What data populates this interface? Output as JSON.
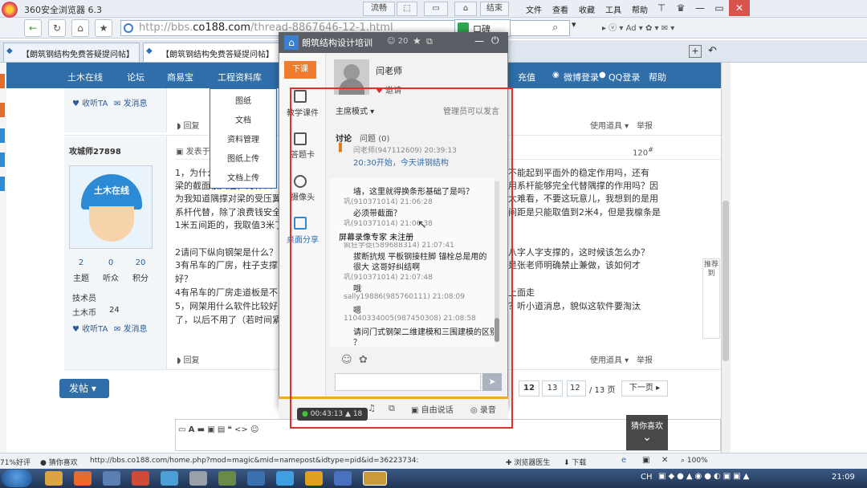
{
  "browser": {
    "title": "360安全浏览器 6.3",
    "top_buttons": [
      "流畅",
      "",
      "",
      "",
      "结束"
    ],
    "menus": [
      "文件",
      "查看",
      "收藏",
      "工具",
      "帮助"
    ],
    "url_prefix": "http://bbs.",
    "url_domain": "co188.com",
    "url_rest": "/thread-8867646-12-1.html",
    "search_label": "口碑",
    "tabs": [
      "【朗筑钢结构免费答疑提问帖】",
      "【朗筑钢结构免费答疑提问帖】"
    ]
  },
  "site_nav": {
    "items": [
      "土木在线",
      "论坛",
      "商易宝",
      "工程资料库",
      "充值",
      "微博登录",
      "QQ登录",
      "帮助"
    ],
    "dropdown": [
      "图纸",
      "文档",
      "资料管理",
      "图纸上传",
      "文档上传"
    ]
  },
  "forum": {
    "user_links": {
      "follow": "收听TA",
      "message": "发消息"
    },
    "reply": "回复",
    "tools": "使用道具",
    "report": "举报",
    "username": "攻城师27898",
    "avatar_text": "土木在线",
    "post_no": "120",
    "post_head": "发表于",
    "stats": [
      {
        "value": "2",
        "label": "主题"
      },
      {
        "value": "0",
        "label": "听众"
      },
      {
        "value": "20",
        "label": "积分"
      }
    ],
    "rank": "技术员",
    "coin_label": "土木币",
    "coin_value": "24",
    "post_lines": [
      "1，为什么",
      "梁的截面很大后，为什么",
      "为我知道隅撑对梁的受压翼",
      "系杆代替，除了浪费钱安全",
      "1米五间距的，我取值3米了",
      "2请问下纵向钢架是什么？",
      "3有吊车的厂房，柱子支撑",
      "好？",
      "4有吊车的厂房走道板是不",
      "5，网架用什么软件比较好",
      "了，以后不用了（若时间紧"
    ],
    "post_right_lines": [
      "不能起到平面外的稳定作用吗，还有",
      "用系杆能够完全代替隅撑的作用吗？因",
      "太难看，不要这玩意儿，我想到的是用",
      "间距是只能取值到2米4，但是我檩条是",
      "八字人字支撑的，这时候该怎么办？",
      "是张老师明确禁止兼做，该如何才",
      "上面走",
      "？听小道消息，貌似这软件要淘汰"
    ],
    "post_button": "发帖",
    "pages": [
      "12",
      "13"
    ],
    "page_input": "12",
    "page_total": "/ 13 页",
    "next": "下一页",
    "share_label": "推荐到"
  },
  "chat": {
    "title": "朗筑结构设计培训",
    "count": "20",
    "xiake": "下课",
    "side": [
      "教学课件",
      "答题卡",
      "摄像头",
      "桌面分享"
    ],
    "teacher": "闫老师",
    "invite": "邀请",
    "mode": "主席模式",
    "admin_note": "管理员可以发言",
    "tab_discuss": "讨论",
    "tab_question": "问题",
    "q_count": "(0)",
    "first_meta": "闫老师(947112609) 20:39:13",
    "first_text": "20:30开始，今天讲钢结构",
    "messages": [
      {
        "text": "墙，这里就得换条形基础了是吗？",
        "meta": "巩(910371014) 21:06:28"
      },
      {
        "text": "必须带截面？",
        "meta": "巩(910371014) 21:06:38"
      },
      {
        "text": "",
        "meta": "疯狂学徒(589688314) 21:07:41"
      },
      {
        "text": "拔断抗规   平板钢接柱脚  锚栓总是用的",
        "meta": ""
      },
      {
        "text": "很大   这哥好纠结啊",
        "meta": "巩(910371014) 21:07:48"
      },
      {
        "text": "哦",
        "meta": "sally19886(985760111) 21:08:09"
      },
      {
        "text": "嗯",
        "meta": "11040334005(987450308) 21:08:58"
      },
      {
        "text": "请问门式钢架二维建模和三围建模的区别",
        "meta": ""
      },
      {
        "text": "？",
        "meta": ""
      }
    ],
    "bottom": [
      "自由说话",
      "录音"
    ],
    "timer": "00:43:13",
    "viewers": "18",
    "caption": "屏幕录像专家 未注册",
    "guess": "猜你喜欢"
  },
  "status": {
    "left": "71%好评",
    "guess": "猜你喜欢",
    "url": "http://bbs.co188.com/home.php?mod=magic&mid=namepost&idtype=pid&id=36223734:",
    "doctor": "浏览器医生",
    "download": "下载",
    "zoom": "100%"
  },
  "taskbar": {
    "ime": "CH",
    "time": "21:09"
  }
}
